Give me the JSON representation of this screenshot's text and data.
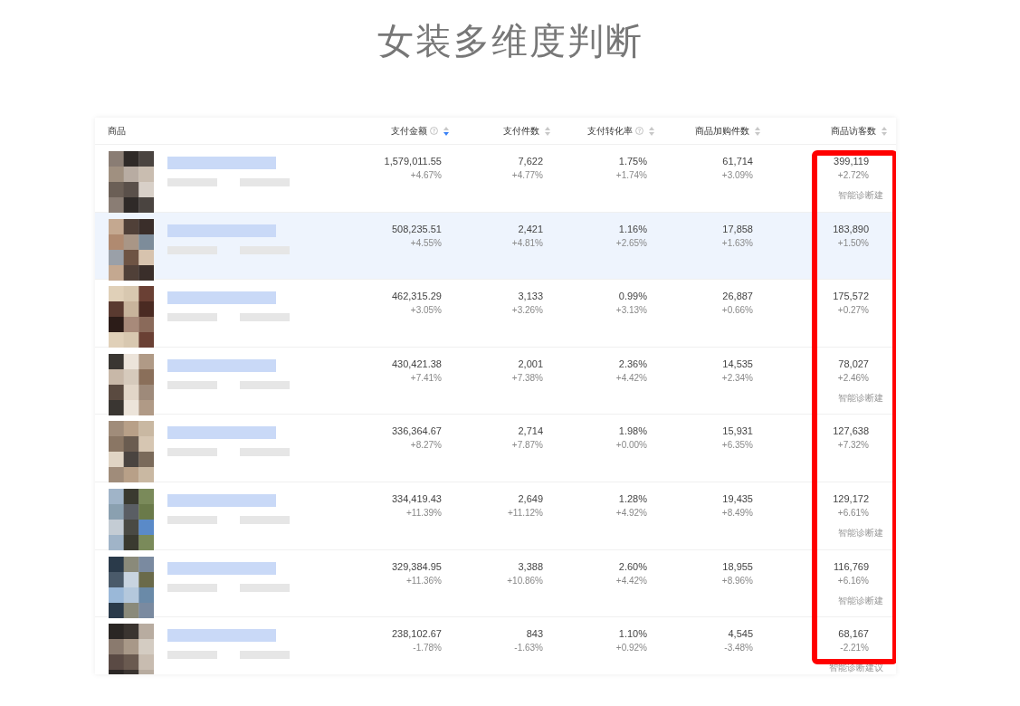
{
  "title": "女装多维度判断",
  "table": {
    "product_header": "商品",
    "columns": [
      {
        "label": "支付金额",
        "help": true,
        "sorted": true
      },
      {
        "label": "支付件数",
        "help": false,
        "sorted": false
      },
      {
        "label": "支付转化率",
        "help": true,
        "sorted": false
      },
      {
        "label": "商品加购件数",
        "help": false,
        "sorted": false
      },
      {
        "label": "商品访客数",
        "help": false,
        "sorted": false
      }
    ],
    "rows": [
      {
        "selected": false,
        "cells": [
          [
            "1,579,011.55",
            "+4.67%"
          ],
          [
            "7,622",
            "+4.77%"
          ],
          [
            "1.75%",
            "+1.74%"
          ],
          [
            "61,714",
            "+3.09%"
          ],
          [
            "399,119",
            "+2.72%"
          ]
        ],
        "suggestion": "智能诊断建"
      },
      {
        "selected": true,
        "cells": [
          [
            "508,235.51",
            "+4.55%"
          ],
          [
            "2,421",
            "+4.81%"
          ],
          [
            "1.16%",
            "+2.65%"
          ],
          [
            "17,858",
            "+1.63%"
          ],
          [
            "183,890",
            "+1.50%"
          ]
        ]
      },
      {
        "selected": false,
        "cells": [
          [
            "462,315.29",
            "+3.05%"
          ],
          [
            "3,133",
            "+3.26%"
          ],
          [
            "0.99%",
            "+3.13%"
          ],
          [
            "26,887",
            "+0.66%"
          ],
          [
            "175,572",
            "+0.27%"
          ]
        ]
      },
      {
        "selected": false,
        "cells": [
          [
            "430,421.38",
            "+7.41%"
          ],
          [
            "2,001",
            "+7.38%"
          ],
          [
            "2.36%",
            "+4.42%"
          ],
          [
            "14,535",
            "+2.34%"
          ],
          [
            "78,027",
            "+2.46%"
          ]
        ],
        "suggestion": "智能诊断建"
      },
      {
        "selected": false,
        "cells": [
          [
            "336,364.67",
            "+8.27%"
          ],
          [
            "2,714",
            "+7.87%"
          ],
          [
            "1.98%",
            "+0.00%"
          ],
          [
            "15,931",
            "+6.35%"
          ],
          [
            "127,638",
            "+7.32%"
          ]
        ]
      },
      {
        "selected": false,
        "cells": [
          [
            "334,419.43",
            "+11.39%"
          ],
          [
            "2,649",
            "+11.12%"
          ],
          [
            "1.28%",
            "+4.92%"
          ],
          [
            "19,435",
            "+8.49%"
          ],
          [
            "129,172",
            "+6.61%"
          ]
        ],
        "suggestion": "智能诊断建"
      },
      {
        "selected": false,
        "cells": [
          [
            "329,384.95",
            "+11.36%"
          ],
          [
            "3,388",
            "+10.86%"
          ],
          [
            "2.60%",
            "+4.42%"
          ],
          [
            "18,955",
            "+8.96%"
          ],
          [
            "116,769",
            "+6.16%"
          ]
        ],
        "suggestion": "智能诊断建"
      },
      {
        "selected": false,
        "cells": [
          [
            "238,102.67",
            "-1.78%"
          ],
          [
            "843",
            "-1.63%"
          ],
          [
            "1.10%",
            "+0.92%"
          ],
          [
            "4,545",
            "-3.48%"
          ],
          [
            "68,167",
            "-2.21%"
          ]
        ],
        "suggestion": "智能诊断建议"
      }
    ]
  }
}
